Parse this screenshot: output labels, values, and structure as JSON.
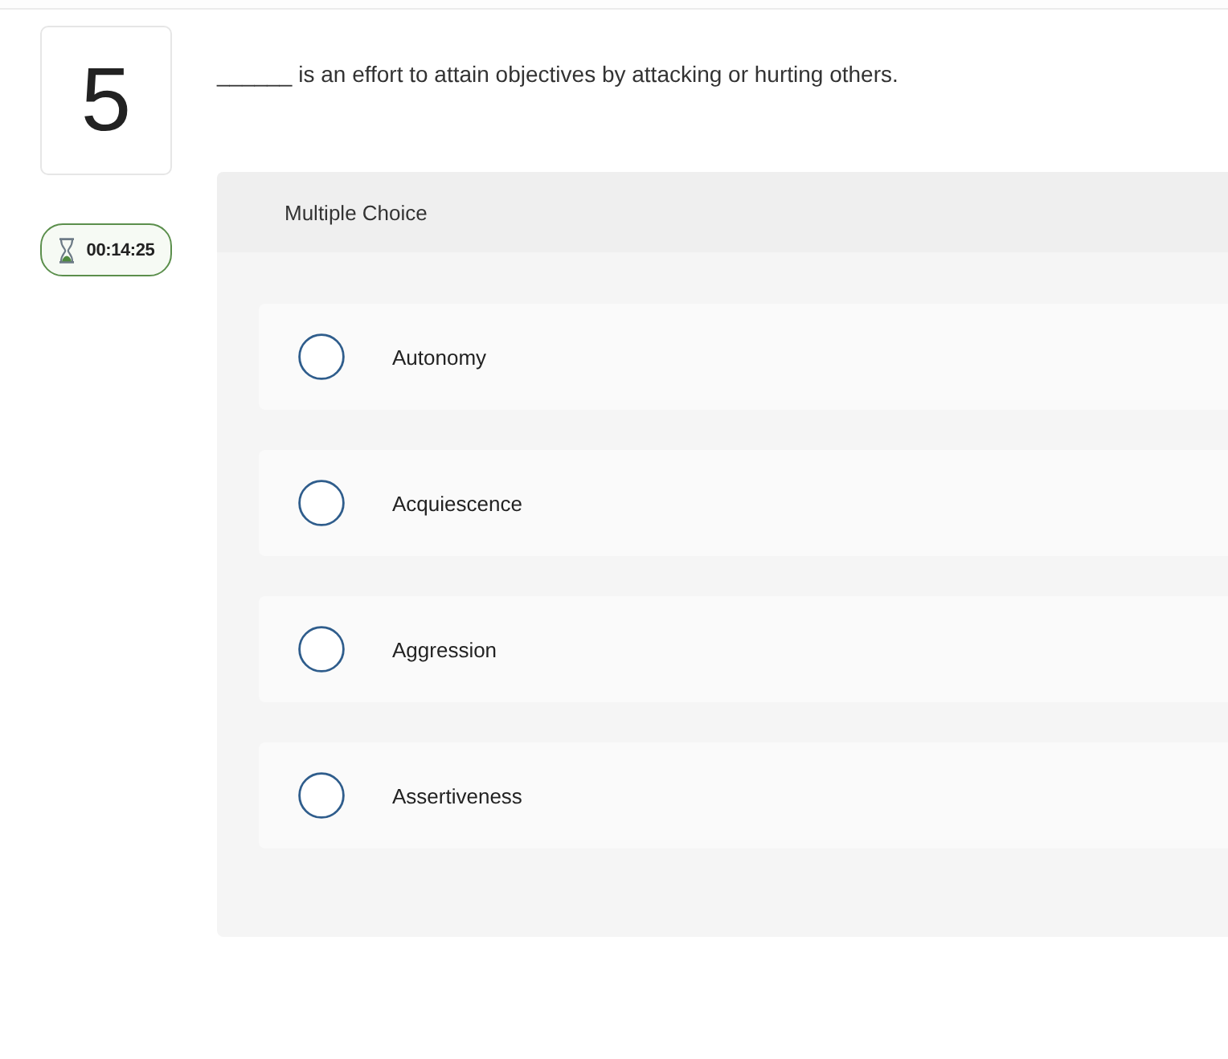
{
  "question": {
    "number": "5",
    "timer": "00:14:25",
    "prompt": "______ is an effort to attain objectives by attacking or hurting others."
  },
  "panel": {
    "type_label": "Multiple Choice",
    "options": [
      {
        "label": "Autonomy",
        "selected": false
      },
      {
        "label": "Acquiescence",
        "selected": false
      },
      {
        "label": "Aggression",
        "selected": false
      },
      {
        "label": "Assertiveness",
        "selected": false
      }
    ]
  }
}
